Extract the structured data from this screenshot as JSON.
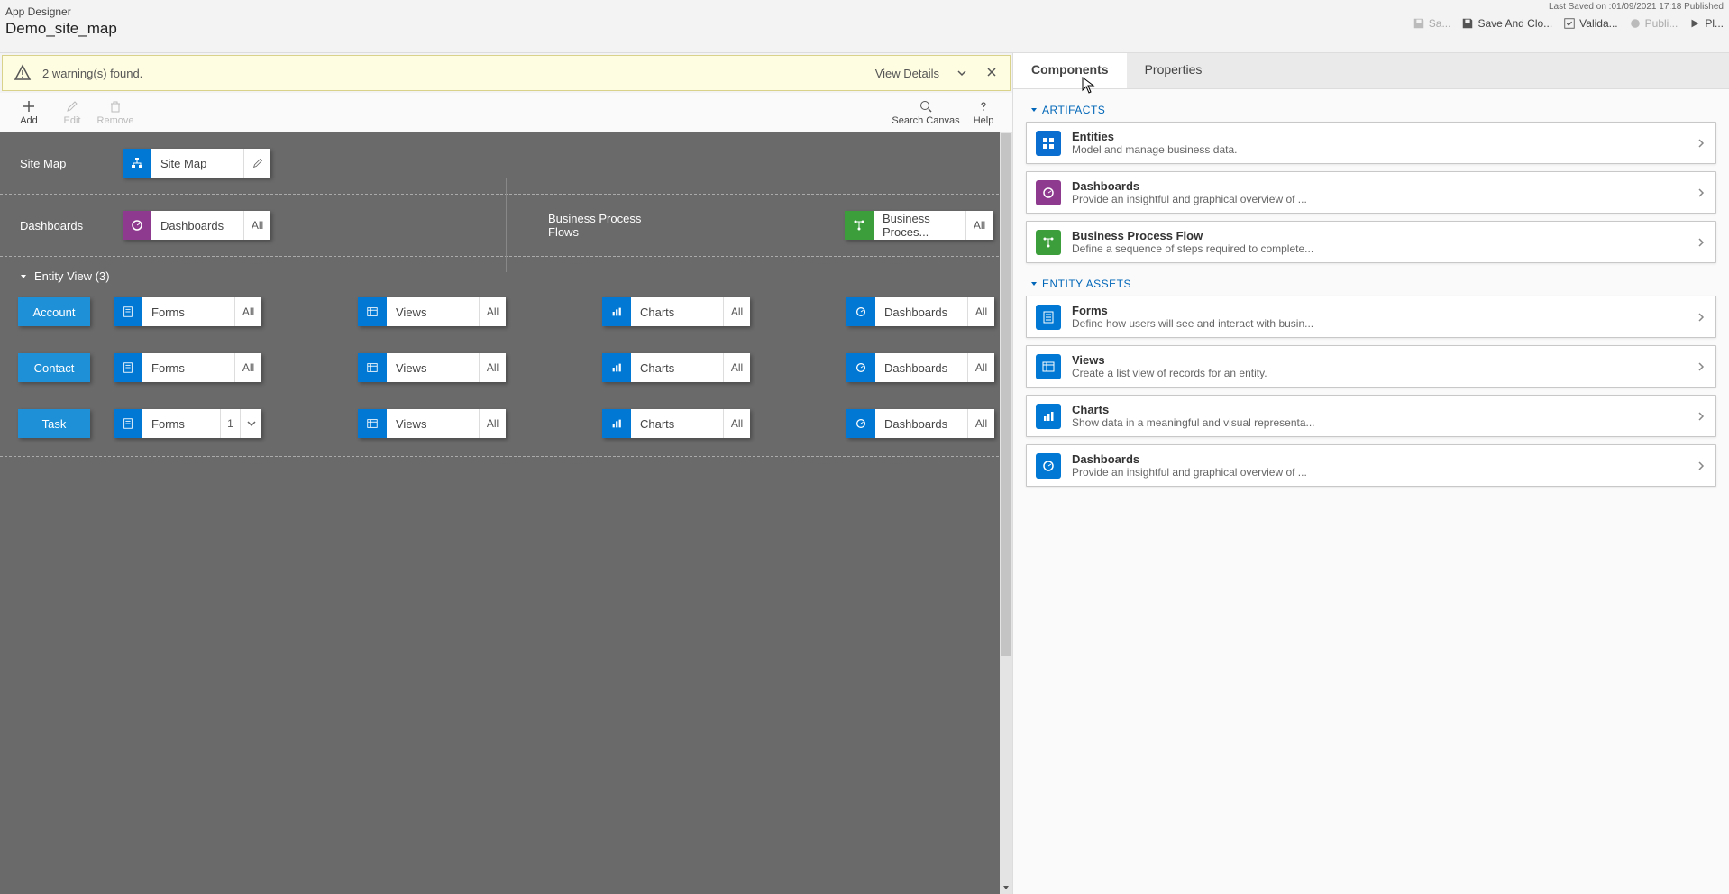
{
  "header": {
    "app_title": "App Designer",
    "app_name": "Demo_site_map",
    "last_saved": "Last Saved on :01/09/2021 17:18 Published",
    "actions": {
      "save": "Sa...",
      "save_close": "Save And Clo...",
      "validate": "Valida...",
      "publish": "Publi...",
      "play": "Pl..."
    }
  },
  "warning": {
    "text": "2 warning(s) found.",
    "view_details": "View Details"
  },
  "toolbar": {
    "add": "Add",
    "edit": "Edit",
    "remove": "Remove",
    "search": "Search Canvas",
    "help": "Help"
  },
  "canvas": {
    "site_map_label": "Site Map",
    "site_map_tile": "Site Map",
    "dashboards_label": "Dashboards",
    "dashboards_tile": "Dashboards",
    "dashboards_count": "All",
    "bpf_label": "Business Process Flows",
    "bpf_tile": "Business Proces...",
    "bpf_count": "All",
    "entity_view_header": "Entity View (3)",
    "entities": [
      {
        "name": "Account",
        "forms_count": "All",
        "views_count": "All",
        "charts_count": "All",
        "dash_count": "All"
      },
      {
        "name": "Contact",
        "forms_count": "All",
        "views_count": "All",
        "charts_count": "All",
        "dash_count": "All"
      },
      {
        "name": "Task",
        "forms_count": "1",
        "forms_has_drop": true,
        "views_count": "All",
        "charts_count": "All",
        "dash_count": "All"
      }
    ],
    "asset_labels": {
      "forms": "Forms",
      "views": "Views",
      "charts": "Charts",
      "dashboards": "Dashboards"
    }
  },
  "tabs": {
    "components": "Components",
    "properties": "Properties"
  },
  "groups": {
    "artifacts": "ARTIFACTS",
    "entity_assets": "ENTITY ASSETS"
  },
  "components": {
    "entities": {
      "title": "Entities",
      "desc": "Model and manage business data."
    },
    "dashboards": {
      "title": "Dashboards",
      "desc": "Provide an insightful and graphical overview of ..."
    },
    "bpf": {
      "title": "Business Process Flow",
      "desc": "Define a sequence of steps required to complete..."
    },
    "forms": {
      "title": "Forms",
      "desc": "Define how users will see and interact with busin..."
    },
    "views": {
      "title": "Views",
      "desc": "Create a list view of records for an entity."
    },
    "charts": {
      "title": "Charts",
      "desc": "Show data in a meaningful and visual representa..."
    },
    "dash2": {
      "title": "Dashboards",
      "desc": "Provide an insightful and graphical overview of ..."
    }
  }
}
